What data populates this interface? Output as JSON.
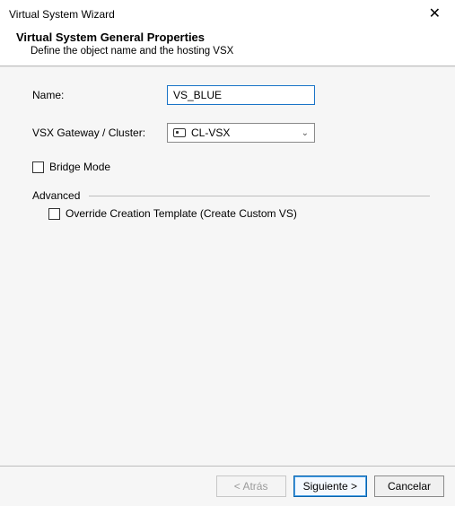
{
  "window": {
    "title": "Virtual System Wizard",
    "close_glyph": "✕"
  },
  "header": {
    "title": "Virtual System General Properties",
    "subtitle": "Define the object name and the hosting VSX"
  },
  "form": {
    "name_label": "Name:",
    "name_value": "VS_BLUE",
    "gateway_label": "VSX Gateway / Cluster:",
    "gateway_value": "CL-VSX",
    "bridge_label": "Bridge Mode",
    "advanced_label": "Advanced",
    "override_label": "Override Creation Template (Create Custom VS)"
  },
  "footer": {
    "back": "< Atrás",
    "next": "Siguiente >",
    "cancel": "Cancelar"
  }
}
